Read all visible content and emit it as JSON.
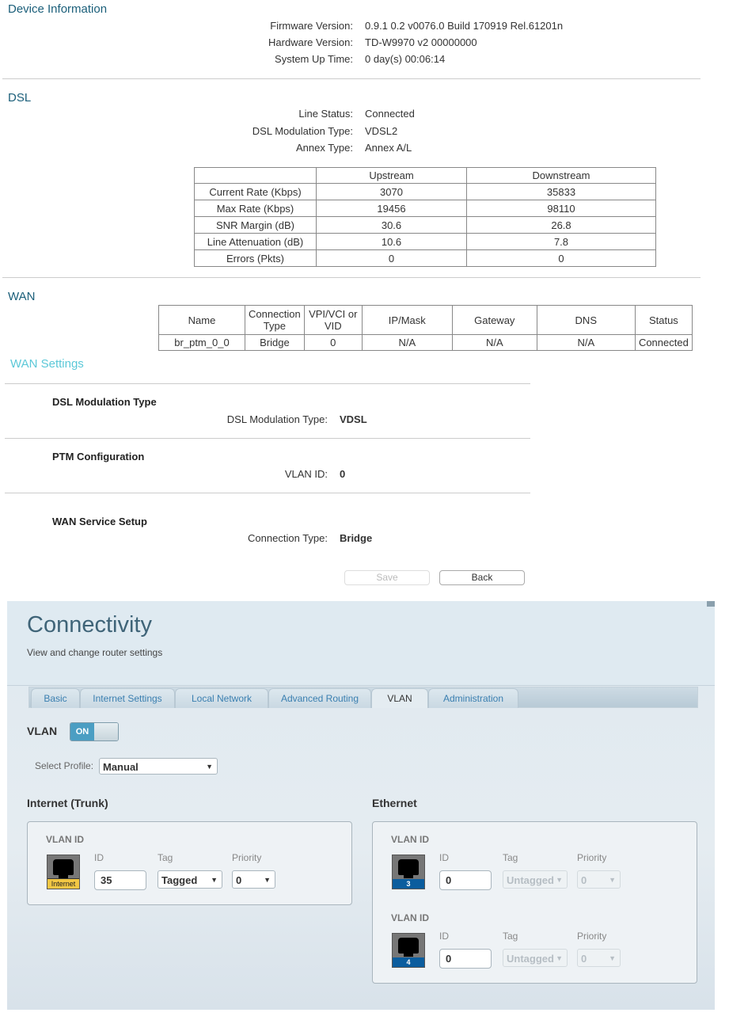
{
  "device_info": {
    "title": "Device Information",
    "rows": [
      {
        "label": "Firmware Version:",
        "value": "0.9.1 0.2 v0076.0 Build 170919 Rel.61201n"
      },
      {
        "label": "Hardware Version:",
        "value": "TD-W9970 v2 00000000"
      },
      {
        "label": "System Up Time:",
        "value": "0 day(s) 00:06:14"
      }
    ]
  },
  "dsl": {
    "title": "DSL",
    "rows": [
      {
        "label": "Line Status:",
        "value": "Connected"
      },
      {
        "label": "DSL Modulation Type:",
        "value": "VDSL2"
      },
      {
        "label": "Annex Type:",
        "value": "Annex A/L"
      }
    ],
    "table": {
      "headers": [
        "",
        "Upstream",
        "Downstream"
      ],
      "rows": [
        [
          "Current Rate (Kbps)",
          "3070",
          "35833"
        ],
        [
          "Max Rate (Kbps)",
          "19456",
          "98110"
        ],
        [
          "SNR Margin (dB)",
          "30.6",
          "26.8"
        ],
        [
          "Line Attenuation (dB)",
          "10.6",
          "7.8"
        ],
        [
          "Errors (Pkts)",
          "0",
          "0"
        ]
      ]
    }
  },
  "wan": {
    "title": "WAN",
    "table": {
      "headers": [
        "Name",
        "Connection Type",
        "VPI/VCI or VID",
        "IP/Mask",
        "Gateway",
        "DNS",
        "Status"
      ],
      "rows": [
        [
          "br_ptm_0_0",
          "Bridge",
          "0",
          "N/A",
          "N/A",
          "N/A",
          "Connected"
        ]
      ]
    }
  },
  "wan_settings": {
    "title": "WAN Settings",
    "sections": [
      {
        "heading": "DSL Modulation Type",
        "label": "DSL Modulation Type:",
        "value": "VDSL"
      },
      {
        "heading": "PTM Configuration",
        "label": "VLAN ID:",
        "value": "0"
      },
      {
        "heading": "WAN Service Setup",
        "label": "Connection Type:",
        "value": "Bridge"
      }
    ],
    "save_label": "Save",
    "back_label": "Back"
  },
  "connectivity": {
    "title": "Connectivity",
    "subtitle": "View and change router settings",
    "tabs": [
      "Basic",
      "Internet Settings",
      "Local Network",
      "Advanced Routing",
      "VLAN",
      "Administration"
    ],
    "active_tab": "VLAN",
    "vlan_label": "VLAN",
    "vlan_toggle": "ON",
    "select_profile_label": "Select Profile:",
    "select_profile_value": "Manual",
    "internet": {
      "heading": "Internet (Trunk)",
      "vlan_id_label": "VLAN ID",
      "port_label": "Internet",
      "id_label": "ID",
      "tag_label": "Tag",
      "priority_label": "Priority",
      "id_value": "35",
      "tag_value": "Tagged",
      "priority_value": "0"
    },
    "ethernet": {
      "heading": "Ethernet",
      "ports": [
        {
          "vlan_id_label": "VLAN ID",
          "port_label": "3",
          "id_label": "ID",
          "tag_label": "Tag",
          "priority_label": "Priority",
          "id_value": "0",
          "tag_value": "Untagged",
          "priority_value": "0"
        },
        {
          "vlan_id_label": "VLAN ID",
          "port_label": "4",
          "id_label": "ID",
          "tag_label": "Tag",
          "priority_label": "Priority",
          "id_value": "0",
          "tag_value": "Untagged",
          "priority_value": "0"
        }
      ]
    },
    "colors": {
      "accent": "#4b9ec3",
      "internet_port": "#f2c744",
      "ethernet_port": "#0b5d9e"
    }
  }
}
